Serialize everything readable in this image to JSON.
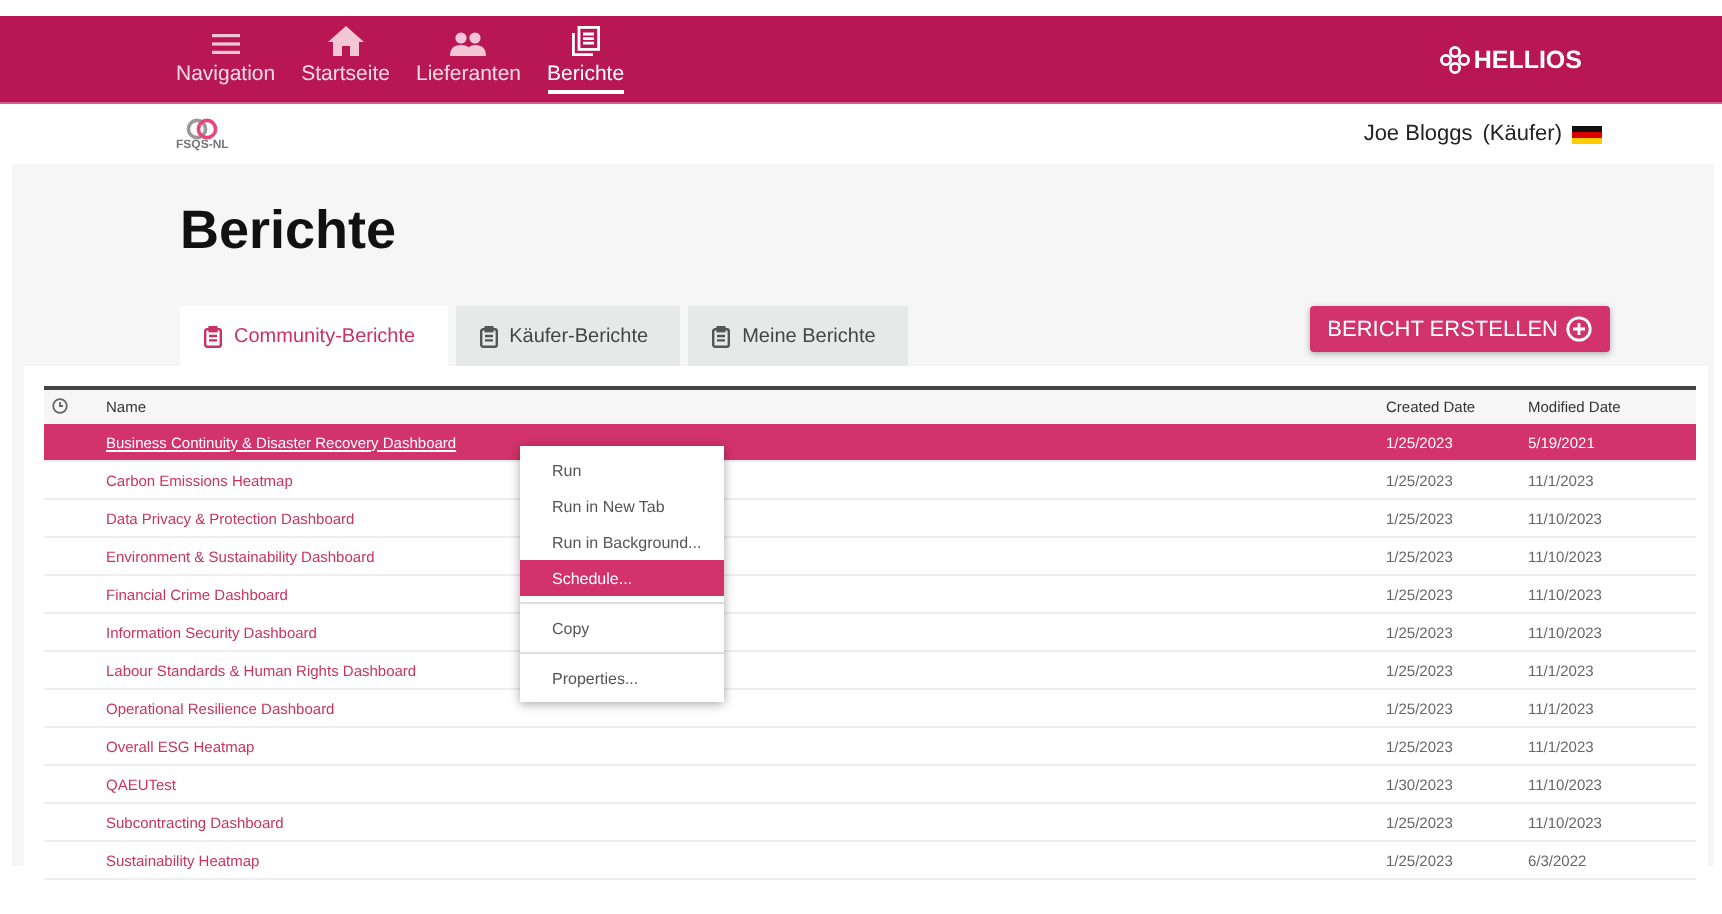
{
  "nav": {
    "items": [
      {
        "kind": "menu",
        "label": "Navigation",
        "selected": false
      },
      {
        "kind": "home",
        "label": "Startseite",
        "selected": false
      },
      {
        "kind": "people",
        "label": "Lieferanten",
        "selected": false
      },
      {
        "kind": "report",
        "label": "Berichte",
        "selected": true
      }
    ],
    "brand": "HELLIOS"
  },
  "header": {
    "org": "FSQS-NL",
    "user": "Joe Bloggs",
    "role": "(Käufer)"
  },
  "title": "Berichte",
  "tabs": [
    {
      "label": "Community-Berichte",
      "selected": true
    },
    {
      "label": "Käufer-Berichte",
      "selected": false
    },
    {
      "label": "Meine Berichte",
      "selected": false
    }
  ],
  "create_button": "BERICHT ERSTELLEN",
  "table": {
    "columns": [
      "Name",
      "Created Date",
      "Modified Date"
    ],
    "rows": [
      {
        "name": "Business Continuity & Disaster Recovery Dashboard",
        "created": "1/25/2023",
        "modified": "5/19/2021",
        "selected": true
      },
      {
        "name": "Carbon Emissions Heatmap",
        "created": "1/25/2023",
        "modified": "11/1/2023",
        "selected": false
      },
      {
        "name": "Data Privacy & Protection Dashboard",
        "created": "1/25/2023",
        "modified": "11/10/2023",
        "selected": false
      },
      {
        "name": "Environment & Sustainability Dashboard",
        "created": "1/25/2023",
        "modified": "11/10/2023",
        "selected": false
      },
      {
        "name": "Financial Crime Dashboard",
        "created": "1/25/2023",
        "modified": "11/10/2023",
        "selected": false
      },
      {
        "name": "Information Security Dashboard",
        "created": "1/25/2023",
        "modified": "11/10/2023",
        "selected": false
      },
      {
        "name": "Labour Standards & Human Rights Dashboard",
        "created": "1/25/2023",
        "modified": "11/1/2023",
        "selected": false
      },
      {
        "name": "Operational Resilience Dashboard",
        "created": "1/25/2023",
        "modified": "11/1/2023",
        "selected": false
      },
      {
        "name": "Overall ESG Heatmap",
        "created": "1/25/2023",
        "modified": "11/1/2023",
        "selected": false
      },
      {
        "name": "QAEUTest",
        "created": "1/30/2023",
        "modified": "11/10/2023",
        "selected": false
      },
      {
        "name": "Subcontracting Dashboard",
        "created": "1/25/2023",
        "modified": "11/10/2023",
        "selected": false
      },
      {
        "name": "Sustainability Heatmap",
        "created": "1/25/2023",
        "modified": "6/3/2022",
        "selected": false
      }
    ]
  },
  "context_menu": {
    "groups": [
      [
        {
          "label": "Run",
          "selected": false
        },
        {
          "label": "Run in New Tab",
          "selected": false
        },
        {
          "label": "Run in Background...",
          "selected": false
        },
        {
          "label": "Schedule...",
          "selected": true
        }
      ],
      [
        {
          "label": "Copy",
          "selected": false
        }
      ],
      [
        {
          "label": "Properties...",
          "selected": false
        }
      ]
    ]
  }
}
